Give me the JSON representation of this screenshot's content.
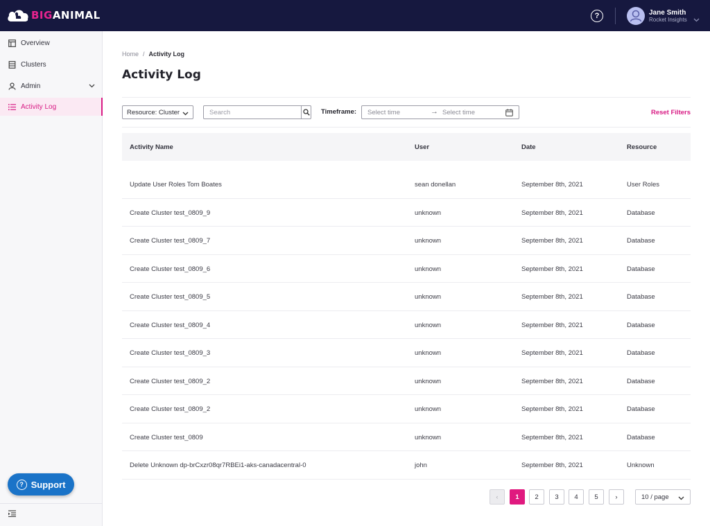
{
  "brand": {
    "part1": "BIG",
    "part2": "ANIMAL"
  },
  "header": {
    "user_name": "Jane Smith",
    "user_org": "Rocket Insights",
    "help_icon": "help-circle-icon"
  },
  "sidebar": {
    "items": [
      {
        "label": "Overview",
        "icon": "layout-icon"
      },
      {
        "label": "Clusters",
        "icon": "database-icon"
      },
      {
        "label": "Admin",
        "icon": "user-icon"
      },
      {
        "label": "Activity Log",
        "icon": "list-icon"
      }
    ],
    "support_label": "Support"
  },
  "breadcrumb": {
    "home": "Home",
    "sep": "/",
    "current": "Activity Log"
  },
  "page_title": "Activity Log",
  "filters": {
    "resource_select": "Resource: Cluster",
    "search_placeholder": "Search",
    "timeframe_label": "Timeframe:",
    "start_placeholder": "Select time",
    "end_placeholder": "Select time",
    "arrow": "→",
    "reset_label": "Reset Filters"
  },
  "table": {
    "columns": [
      "Activity Name",
      "User",
      "Date",
      "Resource"
    ],
    "rows": [
      [
        "Update User Roles Tom Boates",
        "sean donellan",
        "September 8th, 2021",
        "User Roles"
      ],
      [
        "Create Cluster test_0809_9",
        "unknown",
        "September 8th, 2021",
        "Database"
      ],
      [
        "Create Cluster test_0809_7",
        "unknown",
        "September 8th, 2021",
        "Database"
      ],
      [
        "Create Cluster test_0809_6",
        "unknown",
        "September 8th, 2021",
        "Database"
      ],
      [
        "Create Cluster test_0809_5",
        "unknown",
        "September 8th, 2021",
        "Database"
      ],
      [
        "Create Cluster test_0809_4",
        "unknown",
        "September 8th, 2021",
        "Database"
      ],
      [
        "Create Cluster test_0809_3",
        "unknown",
        "September 8th, 2021",
        "Database"
      ],
      [
        "Create Cluster test_0809_2",
        "unknown",
        "September 8th, 2021",
        "Database"
      ],
      [
        "Create Cluster test_0809_2",
        "unknown",
        "September 8th, 2021",
        "Database"
      ],
      [
        "Create Cluster test_0809",
        "unknown",
        "September 8th, 2021",
        "Database"
      ],
      [
        "Delete Unknown dp-brCxzr08qr7RBEi1-aks-canadacentral-0",
        "john",
        "September 8th, 2021",
        "Unknown"
      ]
    ]
  },
  "pagination": {
    "prev": "‹",
    "next": "›",
    "pages": [
      "1",
      "2",
      "3",
      "4",
      "5"
    ],
    "active_page": "1",
    "page_size": "10 / page"
  },
  "colors": {
    "header_bg": "#16183f",
    "accent": "#e0197f",
    "support": "#1a73c8"
  }
}
